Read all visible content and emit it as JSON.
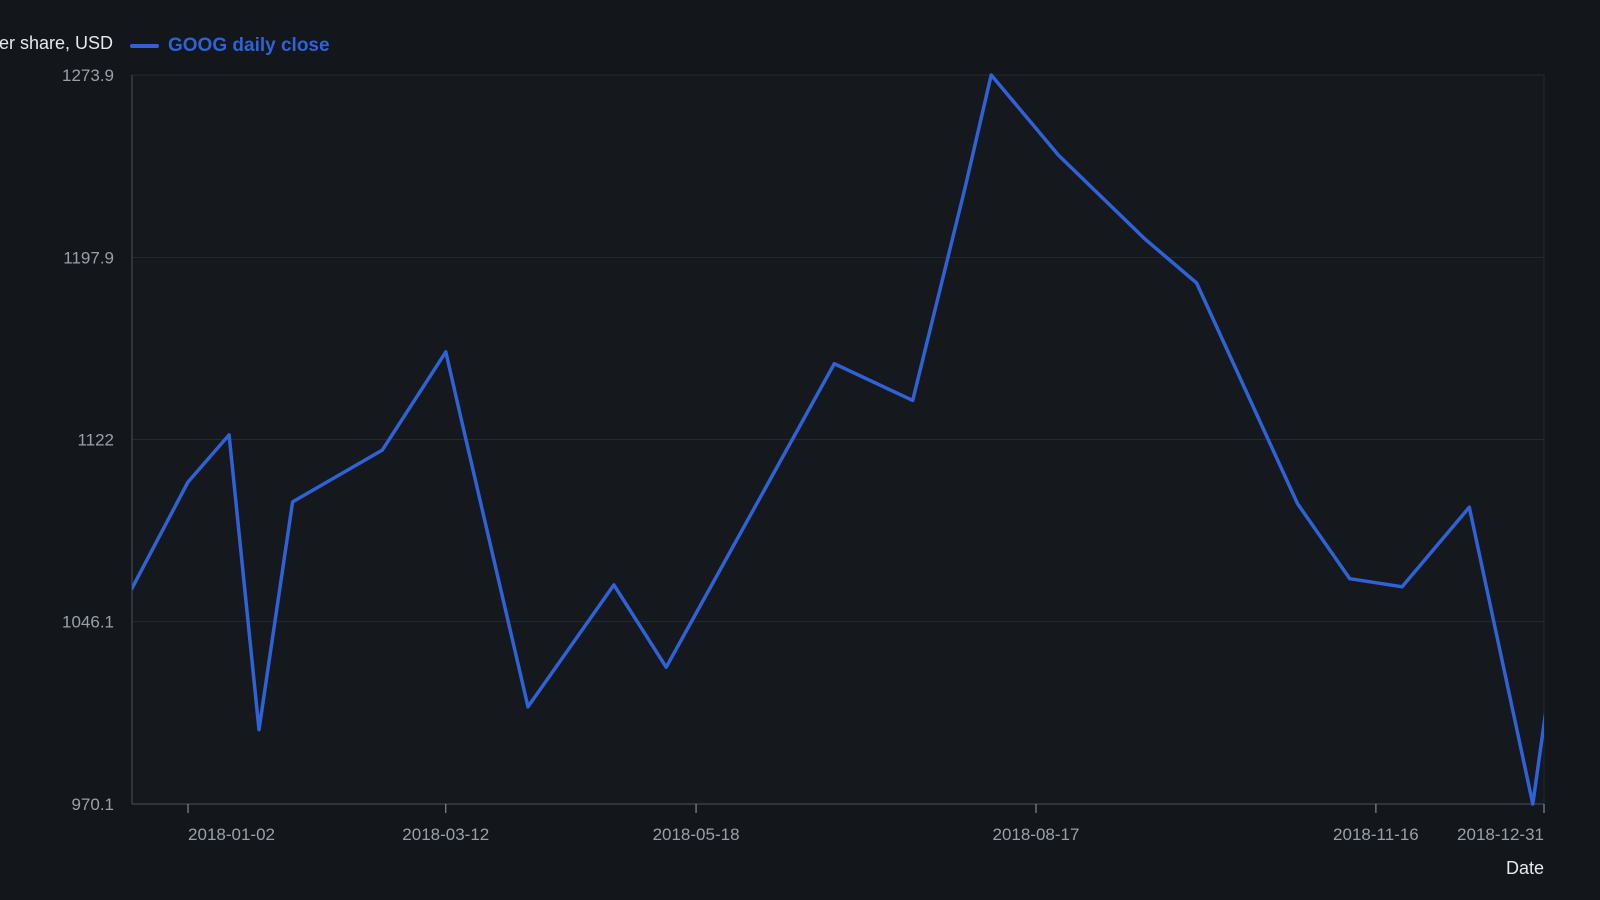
{
  "chart_data": {
    "type": "line",
    "ylabel": "Price per share, USD",
    "xlabel": "Date",
    "x_tick_labels": [
      "2018-01-02",
      "2018-03-12",
      "2018-05-18",
      "2018-08-17",
      "2018-11-16",
      "2018-12-31"
    ],
    "y_tick_labels": [
      "1273.9",
      "1197.9",
      "1122",
      "1046.1",
      "970.1"
    ],
    "ylim": [
      970.1,
      1273.9
    ],
    "xlim": [
      "2017-12-18",
      "2018-12-31"
    ],
    "grid": true,
    "legend_position": "top-left",
    "colors": {
      "background": "#13161b",
      "plot_background": "#15181d",
      "series": "#2f62d6",
      "grid": "#262a31",
      "axis": "#3a3f47",
      "tick_text": "#9aa0a8",
      "title_text": "#e6e8eb"
    },
    "series": [
      {
        "name": "GOOG daily close",
        "x": [
          "2017-12-18",
          "2018-01-02",
          "2018-01-13",
          "2018-01-21",
          "2018-01-30",
          "2018-02-23",
          "2018-03-12",
          "2018-03-16",
          "2018-04-03",
          "2018-04-26",
          "2018-05-10",
          "2018-06-24",
          "2018-07-15",
          "2018-07-29",
          "2018-08-05",
          "2018-08-23",
          "2018-09-15",
          "2018-09-29",
          "2018-10-26",
          "2018-11-09",
          "2018-11-23",
          "2018-12-11",
          "2018-12-28",
          "2019-01-03"
        ],
        "values": [
          1060,
          1104.3,
          1123.9,
          1001.1,
          1096,
          1117.6,
          1158.5,
          1131.4,
          1010.6,
          1061.4,
          1027.1,
          1153.6,
          1138.3,
          1226.8,
          1273.9,
          1240.5,
          1205.8,
          1187.2,
          1095.3,
          1064,
          1060.6,
          1093.8,
          970.1,
          1036.6
        ]
      }
    ]
  }
}
